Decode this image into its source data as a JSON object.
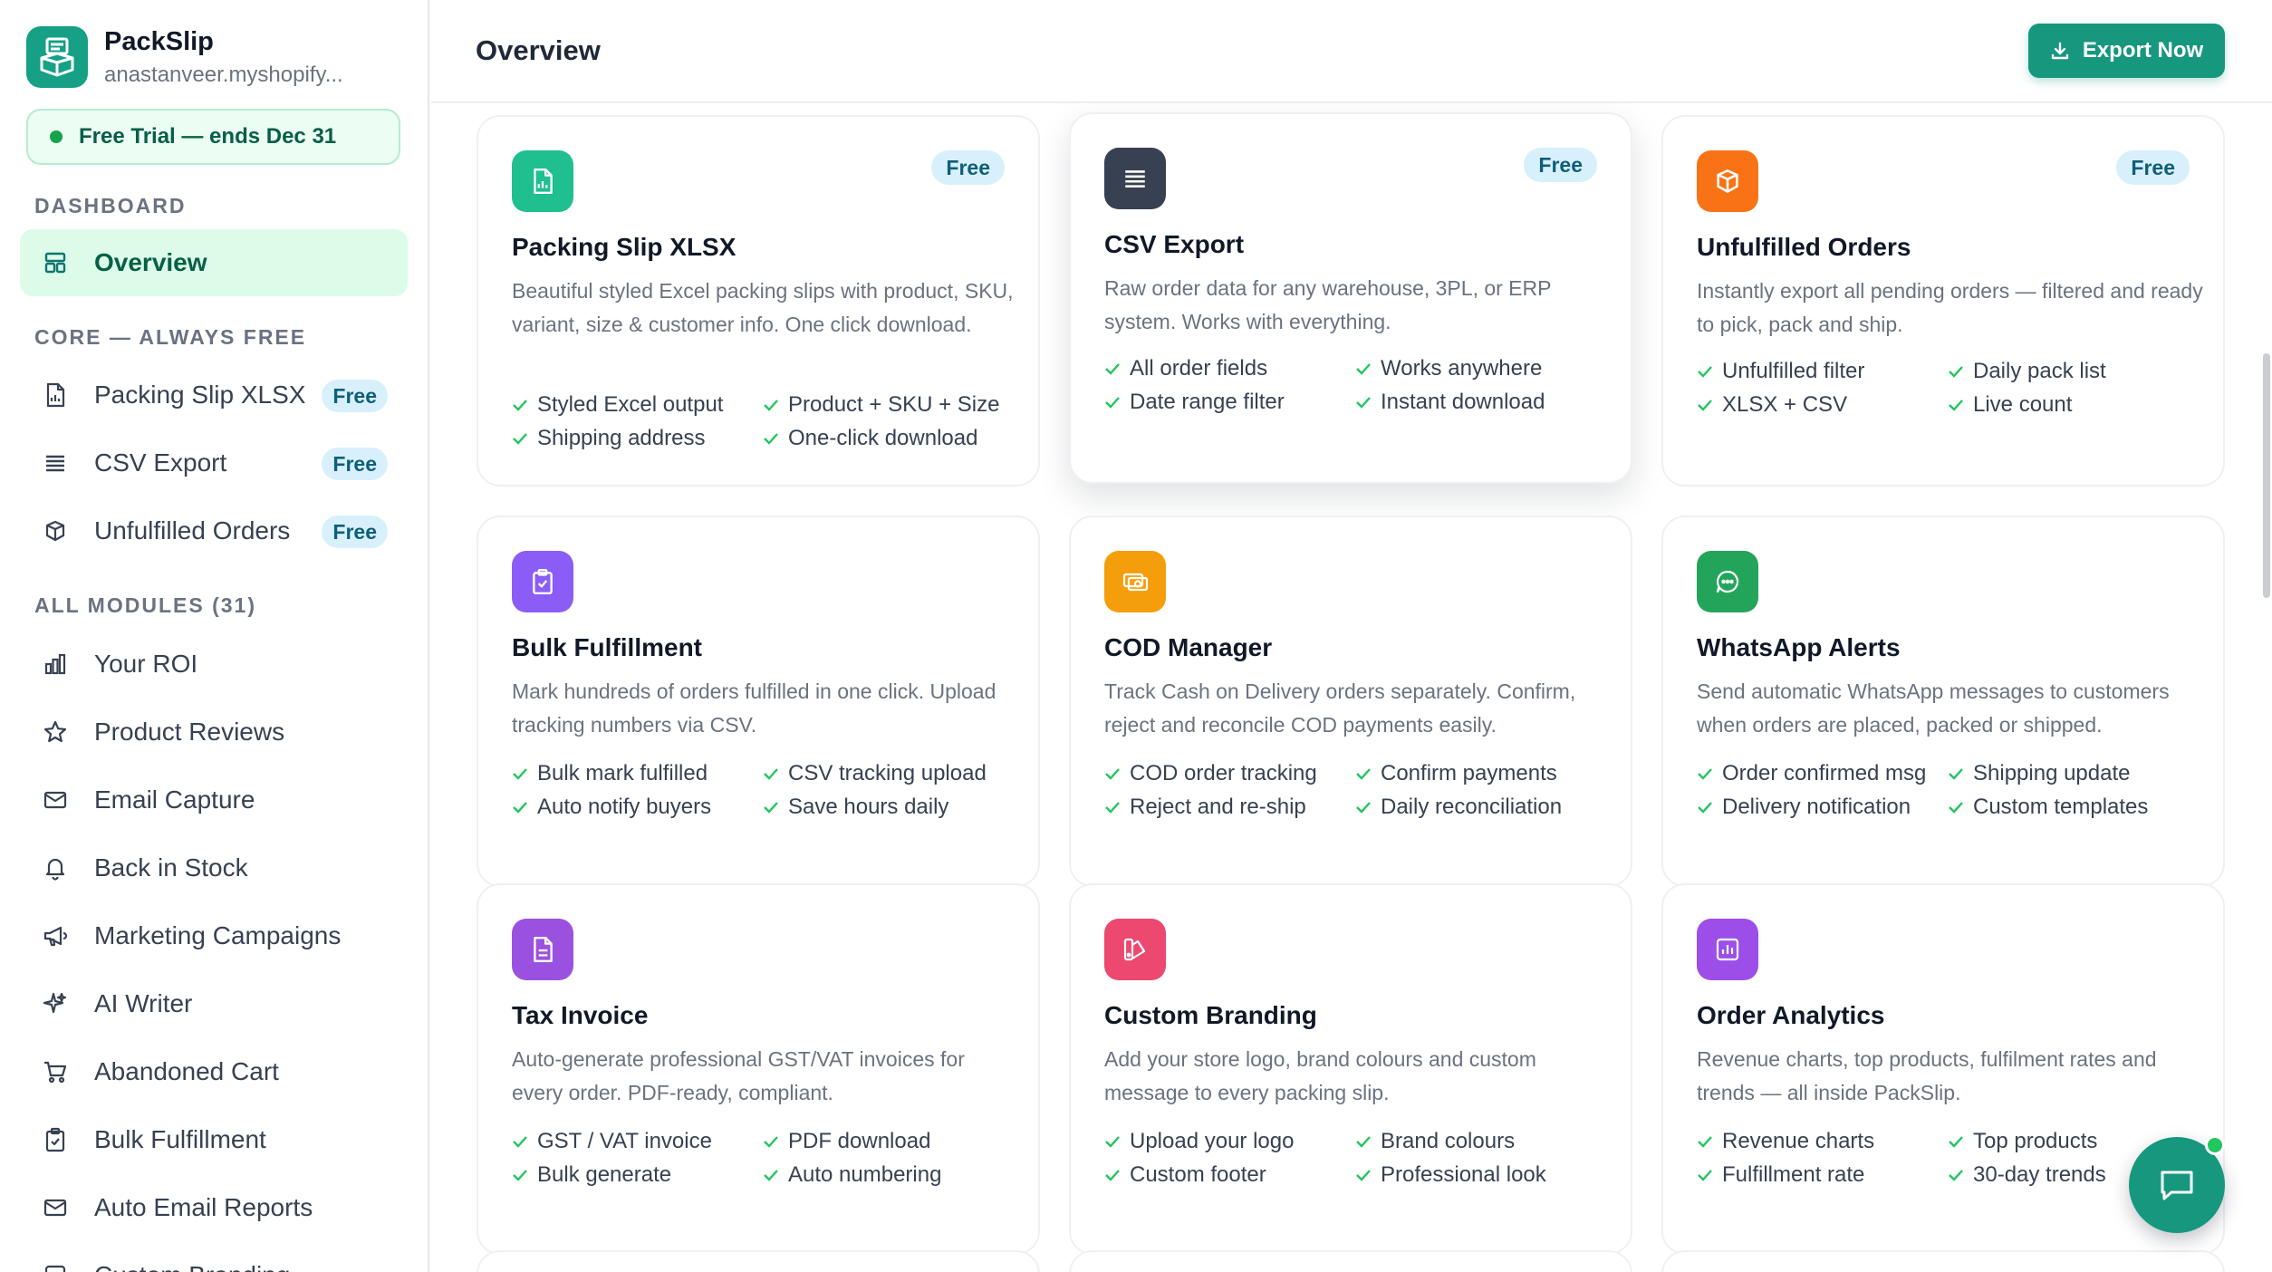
{
  "app": {
    "name": "PackSlip",
    "store": "anastanveer.myshopify...",
    "trial": "Free Trial — ends Dec 31"
  },
  "sidebar": {
    "sections": {
      "dashboard": "DASHBOARD",
      "core": "CORE — ALWAYS FREE",
      "modules": "ALL MODULES (31)"
    },
    "overview": "Overview",
    "core_items": [
      {
        "label": "Packing Slip XLSX",
        "badge": "Free",
        "icon": "file-sheet-icon"
      },
      {
        "label": "CSV Export",
        "badge": "Free",
        "icon": "list-icon"
      },
      {
        "label": "Unfulfilled Orders",
        "badge": "Free",
        "icon": "box-icon"
      }
    ],
    "modules": [
      {
        "label": "Your ROI",
        "icon": "bar-chart-icon"
      },
      {
        "label": "Product Reviews",
        "icon": "star-icon"
      },
      {
        "label": "Email Capture",
        "icon": "mail-icon"
      },
      {
        "label": "Back in Stock",
        "icon": "bell-icon"
      },
      {
        "label": "Marketing Campaigns",
        "icon": "megaphone-icon"
      },
      {
        "label": "AI Writer",
        "icon": "sparkle-icon"
      },
      {
        "label": "Abandoned Cart",
        "icon": "cart-icon"
      },
      {
        "label": "Bulk Fulfillment",
        "icon": "clipboard-check-icon"
      },
      {
        "label": "Auto Email Reports",
        "icon": "mail-icon"
      },
      {
        "label": "Custom Branding",
        "icon": "palette-icon"
      }
    ]
  },
  "header": {
    "title": "Overview",
    "export_label": "Export Now"
  },
  "colors": {
    "brand": "#16977e",
    "badge_bg": "#d7f0fb",
    "check": "#22c55e"
  },
  "cards": [
    {
      "title": "Packing Slip XLSX",
      "badge": "Free",
      "icon": "file-sheet-icon",
      "icon_color": "#1fbf8f",
      "desc": "Beautiful styled Excel packing slips with product, SKU, variant, size & customer info. One click download.",
      "features": [
        "Styled Excel output",
        "Product + SKU + Size",
        "Shipping address",
        "One-click download"
      ]
    },
    {
      "title": "CSV Export",
      "badge": "Free",
      "icon": "list-icon",
      "icon_color": "#374151",
      "desc": "Raw order data for any warehouse, 3PL, or ERP system. Works with everything.",
      "features": [
        "All order fields",
        "Works anywhere",
        "Date range filter",
        "Instant download"
      ]
    },
    {
      "title": "Unfulfilled Orders",
      "badge": "Free",
      "icon": "box-icon",
      "icon_color": "#f97316",
      "desc": "Instantly export all pending orders — filtered and ready to pick, pack and ship.",
      "features": [
        "Unfulfilled filter",
        "Daily pack list",
        "XLSX + CSV",
        "Live count"
      ]
    },
    {
      "title": "Bulk Fulfillment",
      "badge": "",
      "icon": "clipboard-check-icon",
      "icon_color": "#8b5cf6",
      "desc": "Mark hundreds of orders fulfilled in one click. Upload tracking numbers via CSV.",
      "features": [
        "Bulk mark fulfilled",
        "CSV tracking upload",
        "Auto notify buyers",
        "Save hours daily"
      ]
    },
    {
      "title": "COD Manager",
      "badge": "",
      "icon": "cash-icon",
      "icon_color": "#f59e0b",
      "desc": "Track Cash on Delivery orders separately. Confirm, reject and reconcile COD payments easily.",
      "features": [
        "COD order tracking",
        "Confirm payments",
        "Reject and re-ship",
        "Daily reconciliation"
      ]
    },
    {
      "title": "WhatsApp Alerts",
      "badge": "",
      "icon": "chat-bubble-icon",
      "icon_color": "#22a55a",
      "desc": "Send automatic WhatsApp messages to customers when orders are placed, packed or shipped.",
      "features": [
        "Order confirmed msg",
        "Shipping update",
        "Delivery notification",
        "Custom templates"
      ]
    },
    {
      "title": "Tax Invoice",
      "badge": "",
      "icon": "document-icon",
      "icon_color": "#9b51e0",
      "desc": "Auto-generate professional GST/VAT invoices for every order. PDF-ready, compliant.",
      "features": [
        "GST / VAT invoice",
        "PDF download",
        "Bulk generate",
        "Auto numbering"
      ]
    },
    {
      "title": "Custom Branding",
      "badge": "",
      "icon": "palette-icon",
      "icon_color": "#ec4870",
      "desc": "Add your store logo, brand colours and custom message to every packing slip.",
      "features": [
        "Upload your logo",
        "Brand colours",
        "Custom footer",
        "Professional look"
      ]
    },
    {
      "title": "Order Analytics",
      "badge": "",
      "icon": "analytics-icon",
      "icon_color": "#9d4ee8",
      "desc": "Revenue charts, top products, fulfilment rates and trends — all inside PackSlip.",
      "features": [
        "Revenue charts",
        "Top products",
        "Fulfillment rate",
        "30-day trends"
      ]
    }
  ]
}
